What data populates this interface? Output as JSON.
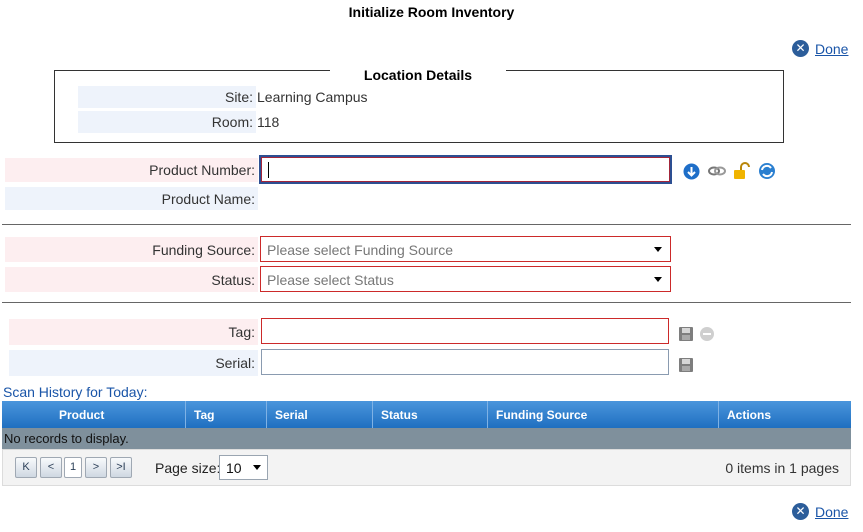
{
  "page": {
    "title": "Initialize Room Inventory",
    "done_label": "Done"
  },
  "location": {
    "legend": "Location Details",
    "site_label": "Site:",
    "site_value": "Learning Campus",
    "room_label": "Room:",
    "room_value": "118"
  },
  "product": {
    "number_label": "Product Number:",
    "number_value": "",
    "name_label": "Product Name:",
    "name_value": ""
  },
  "funding": {
    "label": "Funding Source:",
    "placeholder": "Please select Funding Source"
  },
  "status": {
    "label": "Status:",
    "placeholder": "Please select Status"
  },
  "tag": {
    "label": "Tag:",
    "value": ""
  },
  "serial": {
    "label": "Serial:",
    "value": ""
  },
  "history": {
    "title": "Scan History for Today:",
    "columns": [
      "Product",
      "Tag",
      "Serial",
      "Status",
      "Funding Source",
      "Actions"
    ],
    "empty": "No records to display.",
    "pager": {
      "first": "K",
      "prev": "<",
      "page": "1",
      "next": ">",
      "last": ">I",
      "page_size_label": "Page size:",
      "page_size": "10",
      "items_count": "0",
      "items_text_1": " items in ",
      "pages_count": "1",
      "items_text_2": " pages"
    }
  },
  "colors": {
    "accent": "#1f6fc0",
    "required": "#cc2a2a",
    "link": "#1a55a8"
  },
  "icons": [
    "close-icon",
    "download-icon",
    "link-icon",
    "unlock-icon",
    "refresh-icon",
    "save-icon",
    "cancel-icon"
  ]
}
